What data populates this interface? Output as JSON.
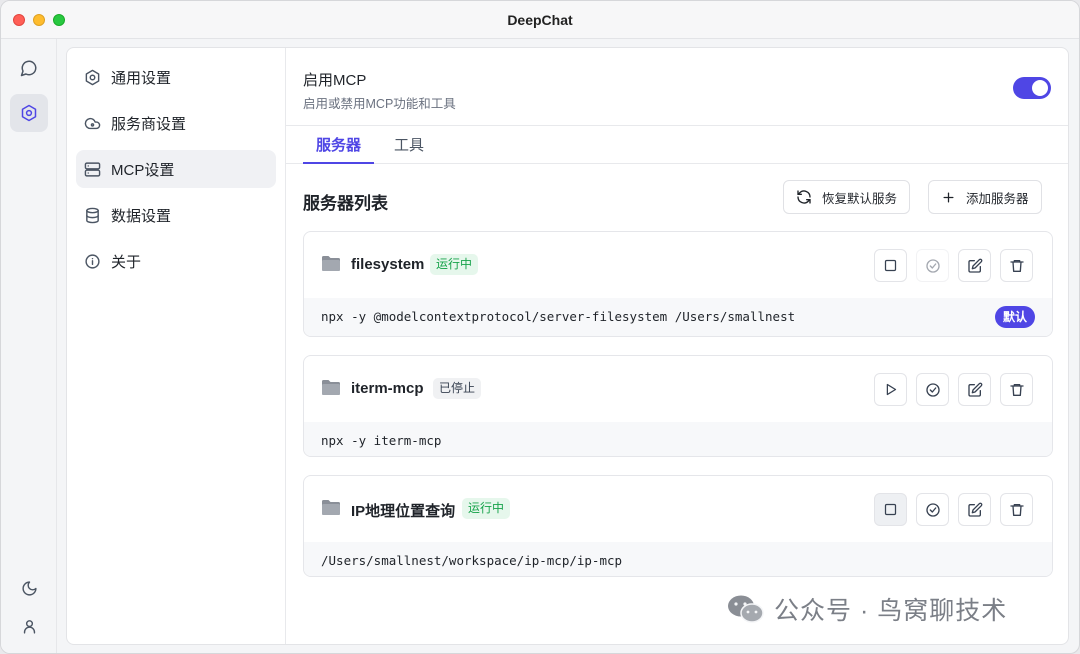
{
  "window": {
    "title": "DeepChat"
  },
  "sidebar": {
    "items": [
      {
        "label": "通用设置",
        "icon": "gear-icon"
      },
      {
        "label": "服务商设置",
        "icon": "cloud-icon"
      },
      {
        "label": "MCP设置",
        "icon": "server-icon",
        "active": true
      },
      {
        "label": "数据设置",
        "icon": "database-icon"
      },
      {
        "label": "关于",
        "icon": "info-icon"
      }
    ]
  },
  "mcp": {
    "title": "启用MCP",
    "subtitle": "启用或禁用MCP功能和工具",
    "enabled": true
  },
  "tabs": [
    {
      "label": "服务器",
      "active": true
    },
    {
      "label": "工具",
      "active": false
    }
  ],
  "server_list": {
    "title": "服务器列表",
    "restore_label": "恢复默认服务",
    "add_label": "添加服务器"
  },
  "servers": [
    {
      "name": "filesystem",
      "status": "运行中",
      "command": "npx -y @modelcontextprotocol/server-filesystem /Users/smallnest",
      "default_badge": "默认"
    },
    {
      "name": "iterm-mcp",
      "status": "已停止",
      "command": "npx -y iterm-mcp"
    },
    {
      "name": "IP地理位置查询",
      "status": "运行中",
      "command": "/Users/smallnest/workspace/ip-mcp/ip-mcp"
    }
  ],
  "watermark": {
    "text": "公众号 · 鸟窝聊技术"
  },
  "colors": {
    "accent": "#4f46e5",
    "running": "#16a34a",
    "running_bg": "#e6f7ec"
  }
}
